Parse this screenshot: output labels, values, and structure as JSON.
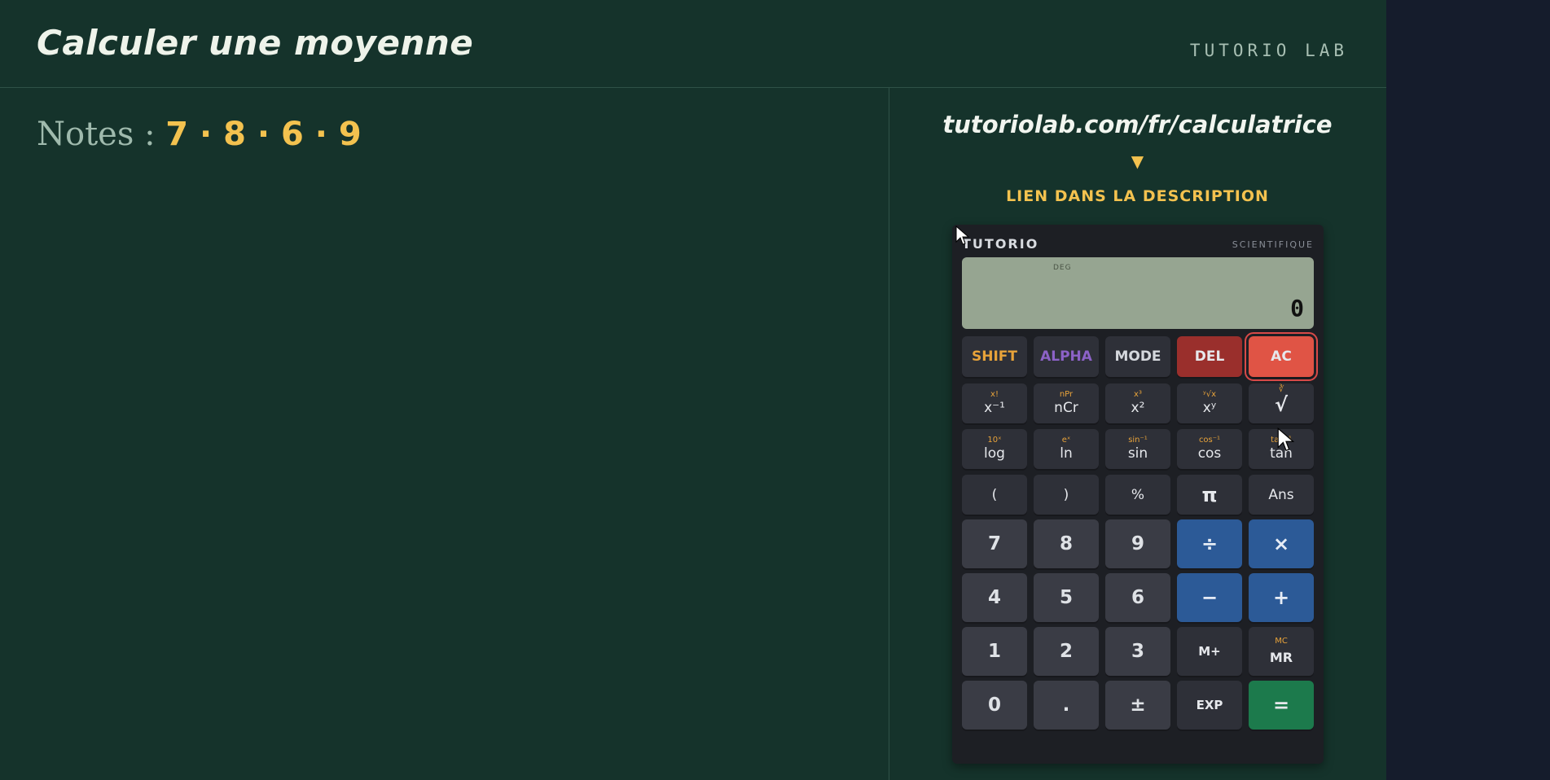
{
  "header": {
    "title": "Calculer une moyenne",
    "brand": "TUTORIO LAB"
  },
  "notes": {
    "label": "Notes :",
    "values": "7 · 8 · 6 · 9"
  },
  "promo": {
    "url": "tutoriolab.com/fr/calculatrice",
    "arrow": "▼",
    "link_text": "LIEN DANS LA DESCRIPTION"
  },
  "calculator": {
    "brand": "TUTORIO",
    "model": "SCIENTIFIQUE",
    "screen": {
      "mode": "DEG",
      "value": "0"
    },
    "row1": {
      "shift": "SHIFT",
      "alpha": "ALPHA",
      "mode": "MODE",
      "del": "DEL",
      "ac": "AC"
    },
    "row2": [
      {
        "sub": "x!",
        "main": "x⁻¹"
      },
      {
        "sub": "nPr",
        "main": "nCr"
      },
      {
        "sub": "x³",
        "main": "x²"
      },
      {
        "sub": "ʸ√x",
        "main": "xʸ"
      },
      {
        "sub": "∛",
        "main": "√"
      }
    ],
    "row3": [
      {
        "sub": "10ˣ",
        "main": "log"
      },
      {
        "sub": "eˣ",
        "main": "ln"
      },
      {
        "sub": "sin⁻¹",
        "main": "sin"
      },
      {
        "sub": "cos⁻¹",
        "main": "cos"
      },
      {
        "sub": "tan⁻¹",
        "main": "tan"
      }
    ],
    "row4": [
      "(",
      ")",
      "%",
      "π",
      "Ans"
    ],
    "row5": [
      "7",
      "8",
      "9",
      "÷",
      "×"
    ],
    "row6": [
      "4",
      "5",
      "6",
      "−",
      "+"
    ],
    "row7": {
      "k1": "1",
      "k2": "2",
      "k3": "3",
      "mplus": "M+",
      "mr_sub": "MC",
      "mr": "MR"
    },
    "row8": {
      "k0": "0",
      "dot": ".",
      "pm": "±",
      "exp": "EXP",
      "eq": "="
    }
  }
}
